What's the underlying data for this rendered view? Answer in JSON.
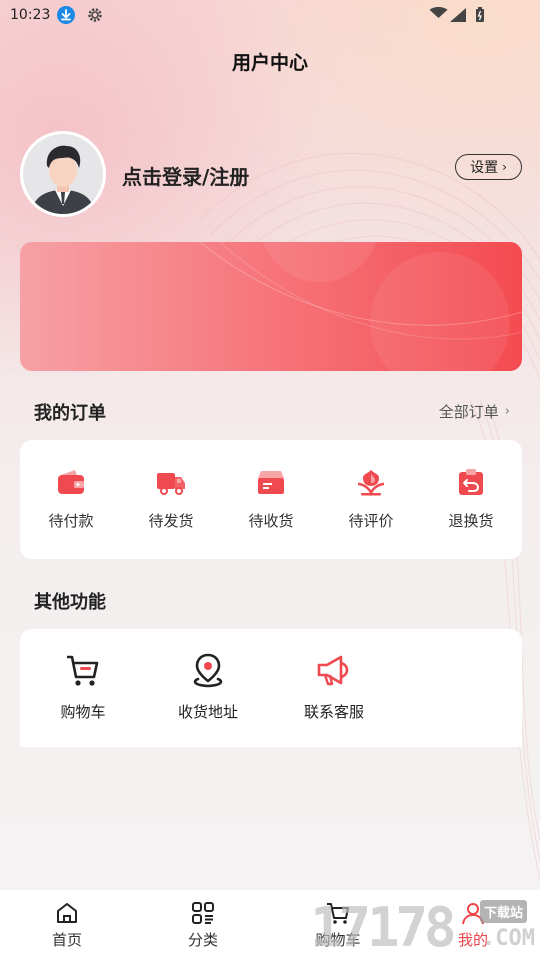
{
  "status_bar": {
    "time": "10:23"
  },
  "header": {
    "title": "用户中心"
  },
  "profile": {
    "login_text": "点击登录/注册",
    "settings_label": "设置",
    "settings_chevron": "›"
  },
  "orders": {
    "title": "我的订单",
    "all_label": "全部订单",
    "all_chevron": "›",
    "items": [
      {
        "label": "待付款",
        "icon": "wallet-icon"
      },
      {
        "label": "待发货",
        "icon": "truck-icon"
      },
      {
        "label": "待收货",
        "icon": "box-icon"
      },
      {
        "label": "待评价",
        "icon": "flower-icon"
      },
      {
        "label": "退换货",
        "icon": "return-icon"
      }
    ]
  },
  "functions": {
    "title": "其他功能",
    "items": [
      {
        "label": "购物车",
        "icon": "cart-icon"
      },
      {
        "label": "收货地址",
        "icon": "location-icon"
      },
      {
        "label": "联系客服",
        "icon": "megaphone-icon"
      }
    ]
  },
  "tabbar": {
    "active": "我的",
    "items": [
      {
        "label": "首页",
        "icon": "home-icon"
      },
      {
        "label": "分类",
        "icon": "category-icon"
      },
      {
        "label": "购物车",
        "icon": "cart-icon"
      },
      {
        "label": "我的",
        "icon": "user-icon"
      }
    ]
  },
  "watermark": {
    "number": "17178",
    "tag": "下载站",
    "domain": ".COM"
  },
  "colors": {
    "accent": "#f0454b",
    "banner_start": "#f6a1a5",
    "banner_end": "#f44b50",
    "icon_red": "#ef4a4f"
  }
}
